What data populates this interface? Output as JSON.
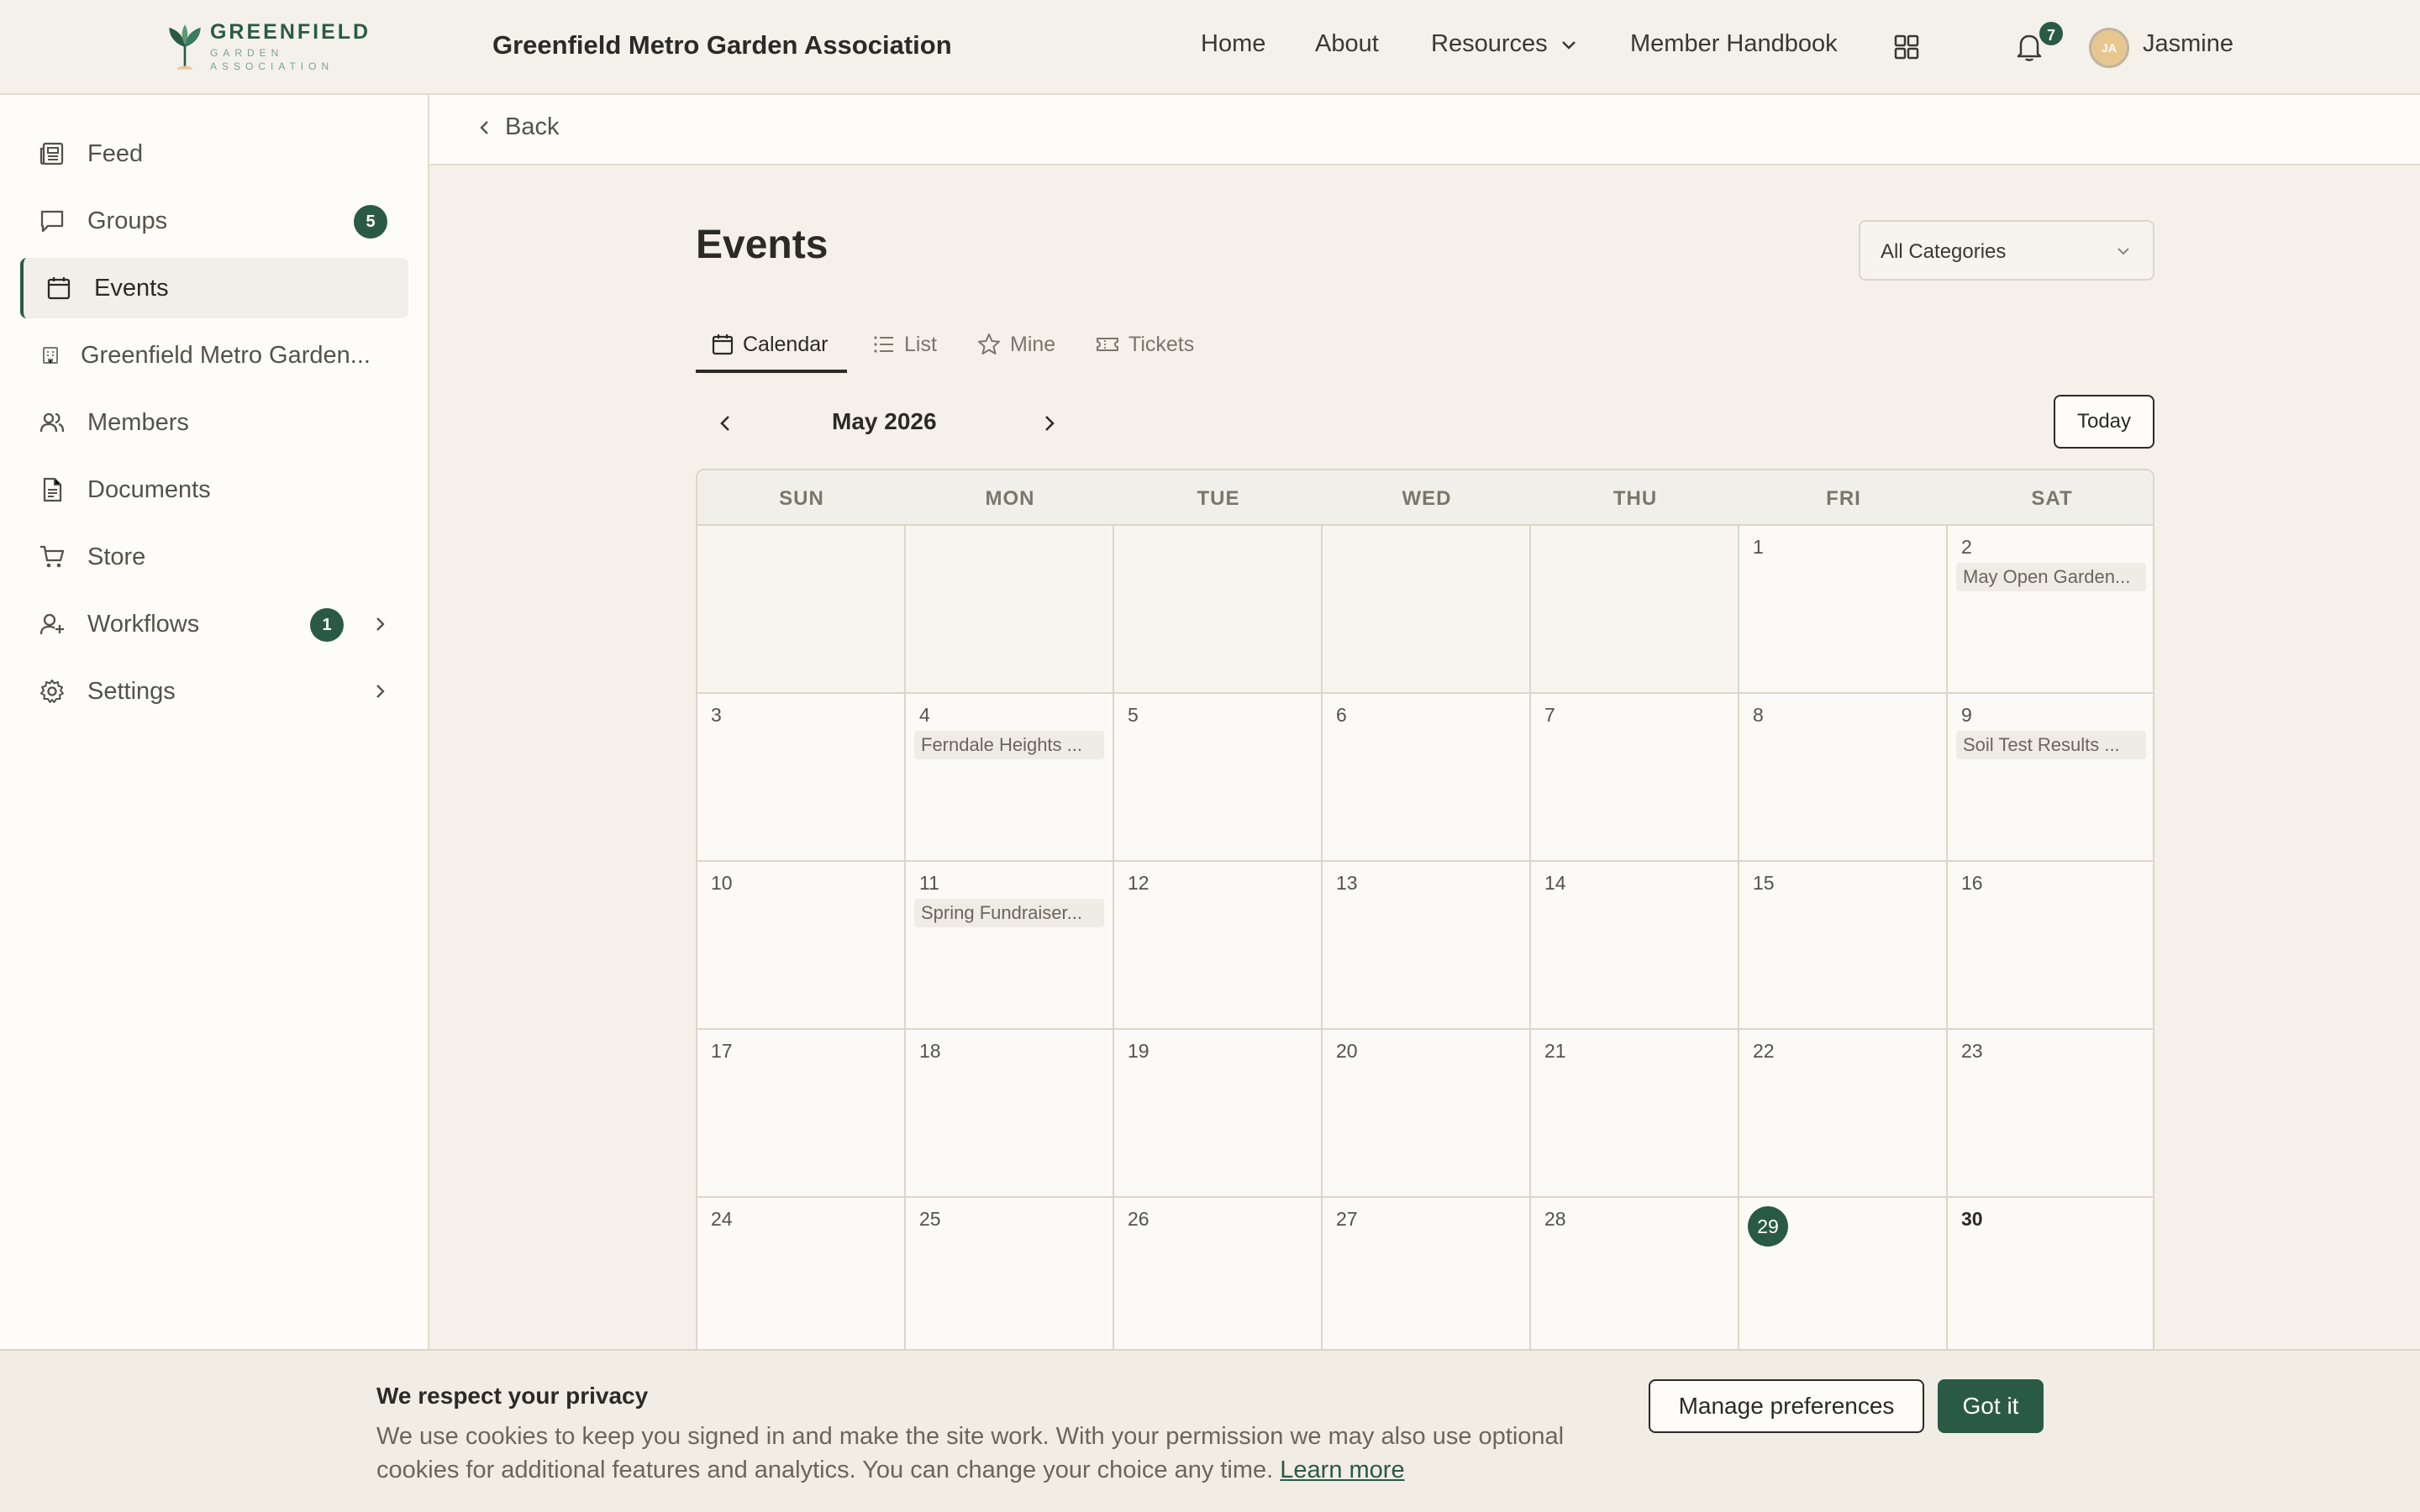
{
  "header": {
    "logo_name": "GREENFIELD",
    "logo_sub": "GARDEN ASSOCIATION",
    "site_title": "Greenfield Metro Garden Association",
    "nav": {
      "home": "Home",
      "about": "About",
      "resources": "Resources",
      "handbook": "Member Handbook"
    },
    "notifications_count": "7",
    "avatar_initials": "JA",
    "user_name": "Jasmine"
  },
  "sidebar": {
    "items": [
      {
        "label": "Feed",
        "icon": "newspaper-icon"
      },
      {
        "label": "Groups",
        "icon": "chat-bubble-icon",
        "badge": "5"
      },
      {
        "label": "Events",
        "icon": "calendar-icon",
        "active": true
      },
      {
        "label": "Greenfield Metro Garden...",
        "icon": "building-icon"
      },
      {
        "label": "Members",
        "icon": "users-icon"
      },
      {
        "label": "Documents",
        "icon": "document-icon"
      },
      {
        "label": "Store",
        "icon": "cart-icon"
      },
      {
        "label": "Workflows",
        "icon": "user-plus-icon",
        "badge": "1"
      },
      {
        "label": "Settings",
        "icon": "gear-icon"
      }
    ]
  },
  "backbar": {
    "back_label": "Back"
  },
  "events": {
    "title": "Events",
    "category_select": "All Categories",
    "tabs": [
      "Calendar",
      "List",
      "Mine",
      "Tickets"
    ],
    "active_tab": "Calendar",
    "month_label": "May 2026",
    "today_label": "Today"
  },
  "calendar": {
    "weekdays": [
      "SUN",
      "MON",
      "TUE",
      "WED",
      "THU",
      "FRI",
      "SAT"
    ],
    "days": {
      "d1": "1",
      "d2": "2",
      "d3": "3",
      "d4": "4",
      "d5": "5",
      "d6": "6",
      "d7": "7",
      "d8": "8",
      "d9": "9",
      "d10": "10",
      "d11": "11",
      "d12": "12",
      "d13": "13",
      "d14": "14",
      "d15": "15",
      "d16": "16",
      "d17": "17",
      "d18": "18",
      "d19": "19",
      "d20": "20",
      "d21": "21",
      "d22": "22",
      "d23": "23",
      "d24": "24",
      "d25": "25",
      "d26": "26",
      "d27": "27",
      "d28": "28",
      "d29": "29",
      "d30": "30"
    },
    "events": {
      "e2": "May Open Garden...",
      "e4": "Ferndale Heights ...",
      "e9": "Soil Test Results ...",
      "e11": "Spring Fundraiser..."
    },
    "today": "29"
  },
  "cookie_banner": {
    "title": "We respect your privacy",
    "text": "We use cookies to keep you signed in and make the site work. With your permission we may also use optional cookies for additional features and analytics. You can change your choice any time.",
    "link": "Learn more",
    "manage_label": "Manage preferences",
    "accept_label": "Got it"
  },
  "colors": {
    "brand_green": "#2a5a45",
    "background": "#f5f1ea",
    "surface": "#fdfcf9"
  }
}
